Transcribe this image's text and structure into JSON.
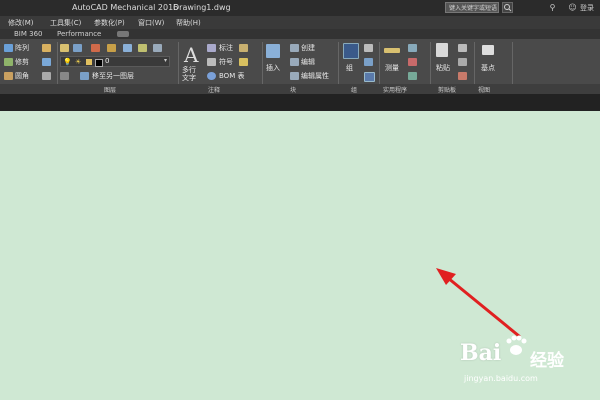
{
  "titlebar": {
    "app_title": "AutoCAD Mechanical 2016",
    "file_name": "Drawing1.dwg",
    "search_placeholder": "键入关键字或短语",
    "login": "登录"
  },
  "menubar": {
    "items": [
      "修改(M)",
      "工具集(C)",
      "参数化(P)",
      "窗口(W)",
      "帮助(H)"
    ]
  },
  "ribbon_tabs": {
    "items": [
      "BIM 360",
      "Performance"
    ]
  },
  "ribbon": {
    "modify": {
      "array": "阵列",
      "trim": "修剪",
      "fillet": "圆角"
    },
    "layers": {
      "layer_value": "0",
      "set_layer": "移至另一图层"
    },
    "annotation": {
      "multiline_text": "多行",
      "multiline_text2": "文字",
      "annotate": "标注",
      "symbol": "符号",
      "bom": "BOM 表"
    },
    "block": {
      "insert": "插入",
      "create": "创建",
      "edit": "编辑",
      "edit_attr": "编辑属性"
    },
    "group": {
      "group": "组"
    },
    "utilities": {
      "measure": "测量"
    },
    "clipboard": {
      "paste": "粘贴"
    },
    "view": {
      "base": "基点"
    }
  },
  "panel_titles": {
    "layers": "图层",
    "annotation": "注释",
    "block": "块",
    "group": "组",
    "utilities": "实用程序",
    "clipboard": "剪贴板",
    "view": "视图"
  },
  "watermark": {
    "brand": "Bai",
    "brand2": "经验",
    "url": "jingyan.baidu.com"
  },
  "colors": {
    "canvas": "#cfe8d3",
    "arrow": "#e02020",
    "ribbon": "#4a4a4a"
  }
}
